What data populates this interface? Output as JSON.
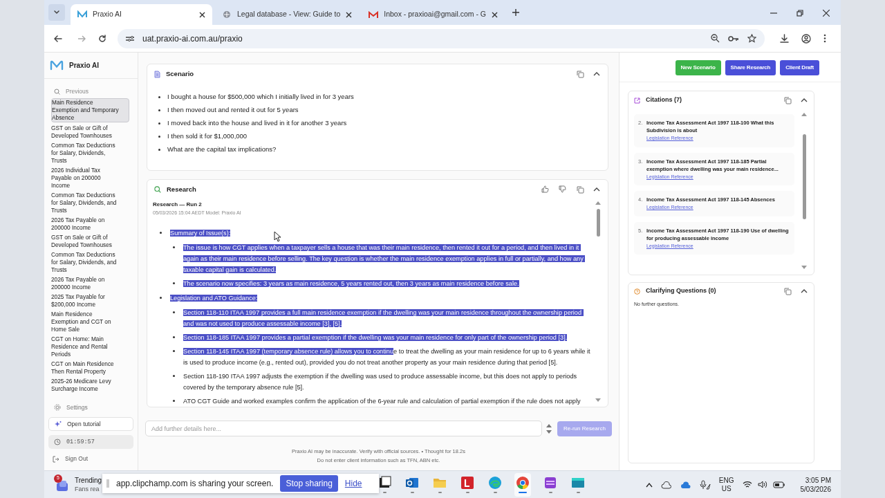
{
  "browser": {
    "tabs": [
      {
        "title": "Praxio AI",
        "selected": true
      },
      {
        "title": "Legal database - View: Guide to",
        "selected": false
      },
      {
        "title": "Inbox - praxioai@gmail.com - G",
        "selected": false
      }
    ],
    "address": "uat.praxio-ai.com.au/praxio"
  },
  "sidebar": {
    "brand": "Praxio AI",
    "search_label": "Previous",
    "history": [
      {
        "label": "Main Residence Exemption and Temporary Absence",
        "selected": true
      },
      {
        "label": "GST on Sale or Gift of Developed Townhouses",
        "selected": false
      },
      {
        "label": "Common Tax Deductions for Salary, Dividends, Trusts",
        "selected": false
      },
      {
        "label": "2026 Individual Tax Payable on 200000 Income",
        "selected": false
      },
      {
        "label": "Common Tax Deductions for Salary, Dividends, and Trusts",
        "selected": false
      },
      {
        "label": "2026 Tax Payable on 200000 Income",
        "selected": false
      },
      {
        "label": "GST on Sale or Gift of Developed Townhouses",
        "selected": false
      },
      {
        "label": "Common Tax Deductions for Salary, Dividends, and Trusts",
        "selected": false
      },
      {
        "label": "2026 Tax Payable on 200000 Income",
        "selected": false
      },
      {
        "label": "2025 Tax Payable for $200,000 Income",
        "selected": false
      },
      {
        "label": "Main Residence Exemption and CGT on Home Sale",
        "selected": false
      },
      {
        "label": "CGT on Home: Main Residence and Rental Periods",
        "selected": false
      },
      {
        "label": "CGT on Main Residence Then Rental Property",
        "selected": false
      },
      {
        "label": "2025-26 Medicare Levy Surcharge Income",
        "selected": false
      }
    ],
    "settings": "Settings",
    "tutorial": "Open tutorial",
    "timer": "01:59:57",
    "sign_out": "Sign Out"
  },
  "scenario": {
    "title": "Scenario",
    "bullets": [
      "I bought a house for $500,000 which I initially lived in for 3 years",
      "I then moved out and rented it out for 5 years",
      "I moved back into the house and lived in it for another 3 years",
      "I then sold it for $1,000,000",
      "What are the capital tax implications?"
    ]
  },
  "research": {
    "title": "Research",
    "run_title": "Research — Run 2",
    "meta": "05/03/2026 15:04 AEDT Model: Praxio AI",
    "outline": [
      {
        "segments": [
          {
            "text": "Summary of Issue(s):",
            "highlighted": true
          }
        ],
        "children": [
          {
            "segments": [
              {
                "text": "The issue is how CGT applies when a taxpayer sells a house that was their main residence, then rented it out for a period, and then lived in it again as their main residence before selling. The key question is whether the main residence exemption applies in full or partially, and how any taxable capital gain is calculated.",
                "highlighted": true
              }
            ]
          },
          {
            "segments": [
              {
                "text": "The scenario now specifies: 3 years as main residence, 5 years rented out, then 3 years as main residence before sale.",
                "highlighted": true
              }
            ]
          }
        ]
      },
      {
        "segments": [
          {
            "text": "Legislation and ATO Guidance:",
            "highlighted": true
          }
        ],
        "children": [
          {
            "segments": [
              {
                "text": "Section 118-110 ITAA 1997 provides a full main residence exemption if the dwelling was your main residence throughout the ownership period and was not used to produce assessable income [3], [5].",
                "highlighted": true
              }
            ]
          },
          {
            "segments": [
              {
                "text": "Section 118-185 ITAA 1997 provides a partial exemption if the dwelling was your main residence for only part of the ownership period [3].",
                "highlighted": true
              }
            ]
          },
          {
            "segments": [
              {
                "text": "Section 118-145 ITAA 1997 (temporary absence rule) allows you to continu",
                "highlighted": true
              },
              {
                "text": "e to treat the dwelling as your main residence for up to 6 years while it is used to produce income (e.g., rented out), provided you do not treat another property as your main residence during that period [5].",
                "highlighted": false
              }
            ]
          },
          {
            "segments": [
              {
                "text": "Section 118-190 ITAA 1997 adjusts the exemption if the dwelling was used to produce assessable income, but this does not apply to periods covered by the temporary absence rule [5].",
                "highlighted": false
              }
            ]
          },
          {
            "segments": [
              {
                "text": "ATO CGT Guide and worked examples confirm the application of the 6-year rule and calculation of partial exemption if the rule does not apply",
                "highlighted": false
              }
            ]
          }
        ]
      }
    ]
  },
  "composer": {
    "placeholder": "Add further details here...",
    "button": "Re-run Research",
    "button_disabled": true,
    "notes": [
      "Praxio AI may be inaccurate. Verify with official sources. • Thought for 18.2s",
      "Do not enter client information such as TFN, ABN etc."
    ]
  },
  "actions": [
    {
      "label": "New Scenario",
      "color": "#3cb44a"
    },
    {
      "label": "Share Research",
      "color": "#4a4fd8"
    },
    {
      "label": "Client Draft",
      "color": "#4a4fd8"
    }
  ],
  "citations": {
    "title": "Citations (7)",
    "items": [
      {
        "number": "2.",
        "title": "Income Tax Assessment Act 1997 118-100 What this Subdivision is about",
        "link": "Legislation Reference"
      },
      {
        "number": "3.",
        "title": "Income Tax Assessment Act 1997 118-185 Partial exemption where dwelling was your main residence...",
        "link": "Legislation Reference"
      },
      {
        "number": "4.",
        "title": "Income Tax Assessment Act 1997 118-145 Absences",
        "link": "Legislation Reference"
      },
      {
        "number": "5.",
        "title": "Income Tax Assessment Act 1997 118-190 Use of dwelling for producing assessable income",
        "link": "Legislation Reference"
      }
    ]
  },
  "clarifying": {
    "title": "Clarifying Questions (0)",
    "empty": "No further questions."
  },
  "taskbar": {
    "badge": "5",
    "widget_title": "Trending",
    "widget_sub": "Fans rea",
    "share_message": "app.clipchamp.com is sharing your screen.",
    "stop": "Stop sharing",
    "hide": "Hide",
    "apps": [
      {
        "kind": "square",
        "active": false
      },
      {
        "kind": "outlook",
        "active": false
      },
      {
        "kind": "folder",
        "active": false
      },
      {
        "kind": "letter",
        "active": false
      },
      {
        "kind": "edge",
        "active": false
      },
      {
        "kind": "chrome",
        "active": true
      },
      {
        "kind": "clipchamp",
        "active": false
      },
      {
        "kind": "window",
        "active": false
      }
    ],
    "lang": "ENG",
    "region": "US",
    "time": "3:05 PM",
    "date": "5/03/2026"
  }
}
